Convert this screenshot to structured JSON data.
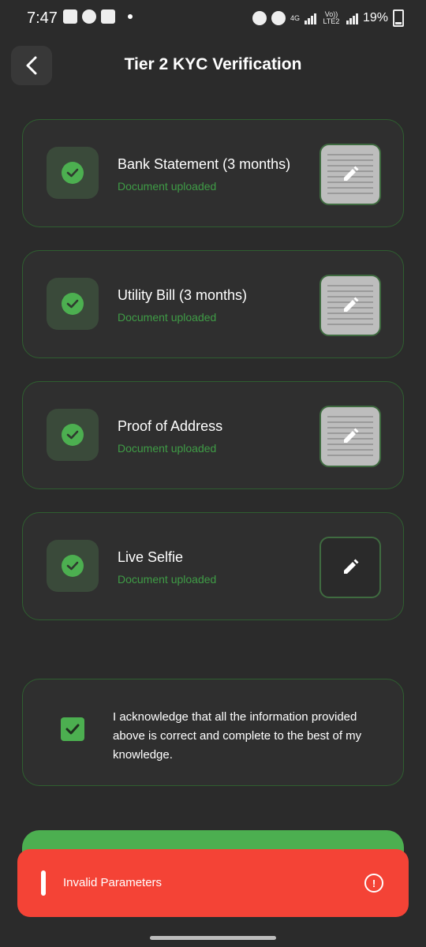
{
  "status_bar": {
    "time": "7:47",
    "battery": "19%",
    "network_label": "4G",
    "volte_label": "Vo)) LTE2"
  },
  "header": {
    "title": "Tier 2 KYC Verification"
  },
  "documents": [
    {
      "title": "Bank Statement (3 months)",
      "status": "Document uploaded"
    },
    {
      "title": "Utility Bill (3 months)",
      "status": "Document uploaded"
    },
    {
      "title": "Proof of Address",
      "status": "Document uploaded"
    },
    {
      "title": "Live Selfie",
      "status": "Document uploaded"
    }
  ],
  "acknowledgement": {
    "checked": true,
    "text": "I acknowledge that all the information provided above is correct and complete to the best of my knowledge."
  },
  "toast": {
    "message": "Invalid Parameters",
    "color": "#f44336"
  },
  "colors": {
    "accent": "#4caf50",
    "status_text": "#3f9c46",
    "background": "#2b2b2b"
  }
}
